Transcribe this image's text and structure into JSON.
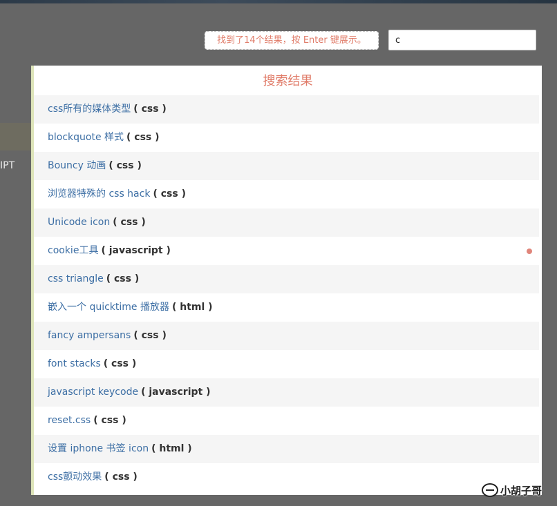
{
  "background": {
    "side_text": "IPT"
  },
  "search": {
    "hint": "找到了14个结果，按 Enter 键展示。",
    "value": "c"
  },
  "results": {
    "title": "搜索结果",
    "items": [
      {
        "title": "css所有的媒体类型",
        "category": "( css )"
      },
      {
        "title": "blockquote 样式",
        "category": "( css )"
      },
      {
        "title": "Bouncy 动画",
        "category": "( css )"
      },
      {
        "title": "浏览器特殊的 css hack",
        "category": "( css )"
      },
      {
        "title": "Unicode icon",
        "category": "( css )"
      },
      {
        "title": "cookie工具",
        "category": "( javascript )"
      },
      {
        "title": "css triangle",
        "category": "( css )"
      },
      {
        "title": "嵌入一个 quicktime 播放器",
        "category": "( html )"
      },
      {
        "title": "fancy ampersans",
        "category": "( css )"
      },
      {
        "title": "font stacks",
        "category": "( css )"
      },
      {
        "title": "javascript keycode",
        "category": "( javascript )"
      },
      {
        "title": "reset.css",
        "category": "( css )"
      },
      {
        "title": "设置 iphone 书签 icon",
        "category": "( html )"
      },
      {
        "title": "css颤动效果",
        "category": "( css )"
      }
    ],
    "active_index": 5
  },
  "watermark": {
    "text": "小胡子哥"
  },
  "colors": {
    "accent": "#e07b68",
    "link": "#3c6ea4",
    "overlay": "#666666"
  }
}
